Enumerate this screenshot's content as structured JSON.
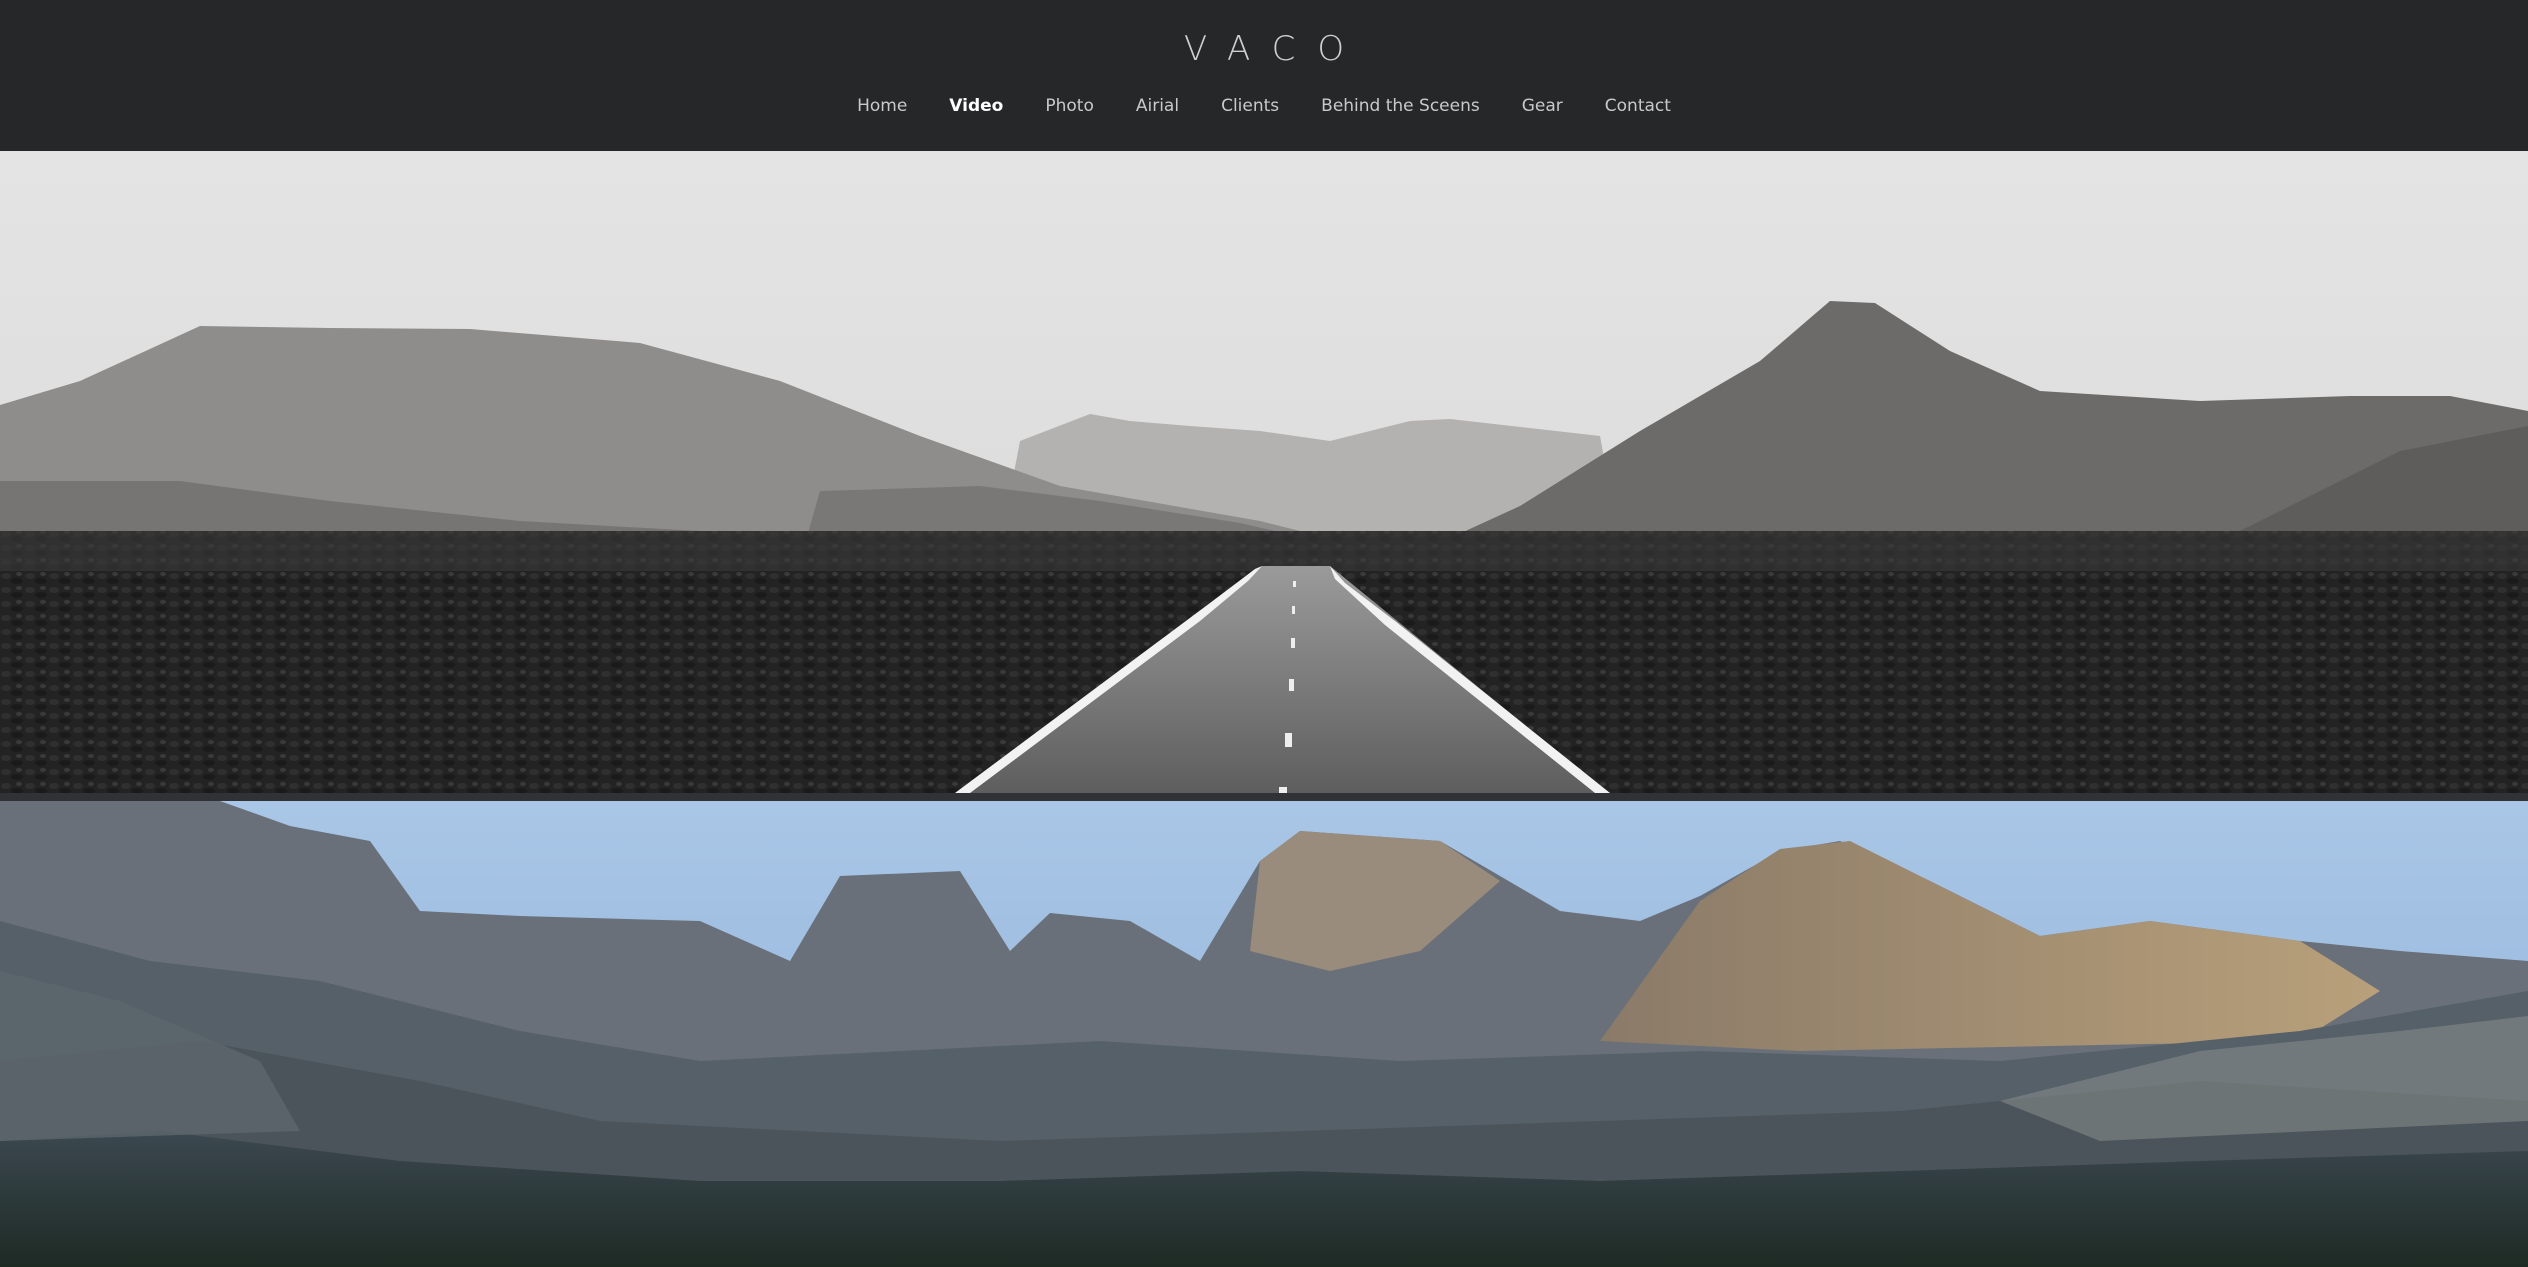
{
  "site": {
    "brand": "VACO"
  },
  "nav": {
    "items": [
      {
        "label": "Home"
      },
      {
        "label": "Video",
        "active": true
      },
      {
        "label": "Photo"
      },
      {
        "label": "Airial"
      },
      {
        "label": "Clients"
      },
      {
        "label": "Behind the Sceens"
      },
      {
        "label": "Gear"
      },
      {
        "label": "Contact"
      }
    ]
  },
  "colors": {
    "header_bg": "#262729",
    "nav_text": "#c9c9c9",
    "nav_active": "#ffffff"
  },
  "images": [
    {
      "name": "hero-road-image",
      "depicts": "desert-road-landscape"
    },
    {
      "name": "hero-mountains-image",
      "depicts": "rocky-mountain-range"
    }
  ]
}
